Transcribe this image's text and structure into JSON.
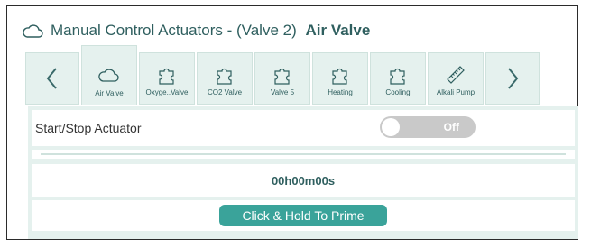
{
  "header": {
    "title": "Manual Control Actuators - (Valve 2)",
    "name": "Air Valve"
  },
  "tabs": [
    {
      "label": "Air Valve",
      "icon": "cloud-icon"
    },
    {
      "label": "Oxyge..Valve",
      "icon": "puzzle-icon"
    },
    {
      "label": "CO2 Valve",
      "icon": "puzzle-icon"
    },
    {
      "label": "Valve 5",
      "icon": "puzzle-icon"
    },
    {
      "label": "Heating",
      "icon": "puzzle-icon"
    },
    {
      "label": "Cooling",
      "icon": "puzzle-icon"
    },
    {
      "label": "Alkali Pump",
      "icon": "ruler-icon"
    }
  ],
  "actuator": {
    "label": "Start/Stop Actuator",
    "toggle_state": "Off"
  },
  "timer": "00h00m00s",
  "prime_button": "Click & Hold To Prime",
  "colors": {
    "accent": "#3aa39a",
    "tab_bg": "#e5f1ee",
    "text": "#2f5f5f",
    "toggle_off": "#c9c9c9"
  }
}
